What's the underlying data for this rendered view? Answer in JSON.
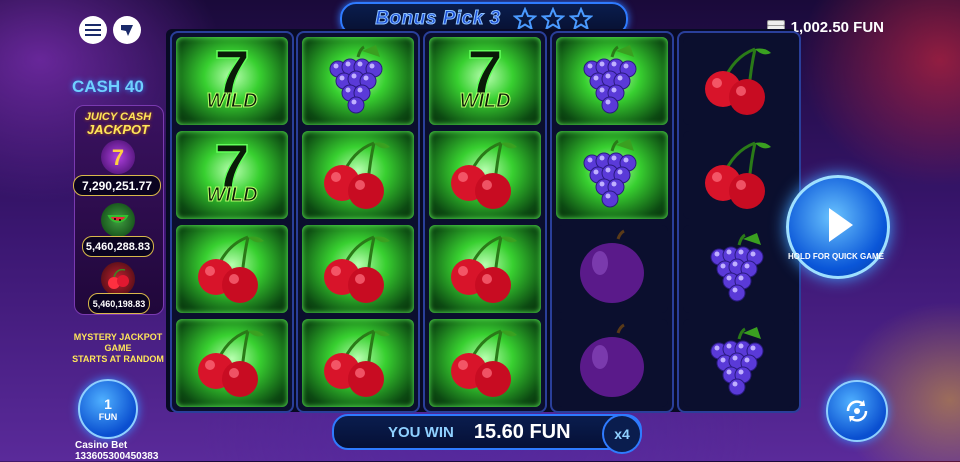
{
  "header": {
    "menu_icon": "hamburger-menu-icon",
    "nav_icon": "arrow-logo-icon",
    "title": "Bonus Pick 3",
    "stars": 3,
    "balance": "1,002.50 FUN",
    "balance_icon": "coin-stack-icon"
  },
  "jackpot": {
    "cash_label": "CASH 40",
    "title_line1": "JUICY CASH",
    "title_line2": "JACKPOT",
    "tiers": [
      {
        "icon": "seven-icon",
        "value": "7,290,251.77"
      },
      {
        "icon": "watermelon-icon",
        "value": "5,460,288.83"
      },
      {
        "icon": "cherry-icon",
        "value": "5,460,198.83"
      }
    ],
    "mystery_line1": "MYSTERY JACKPOT GAME",
    "mystery_line2": "STARTS AT RANDOM"
  },
  "bet": {
    "value": "1",
    "unit": "FUN",
    "label": "Casino Bet",
    "id": "133605300450383"
  },
  "reels": [
    {
      "symbols": [
        "wild",
        "wild",
        "cherry",
        "cherry"
      ],
      "highlight": [
        true,
        true,
        true,
        true
      ]
    },
    {
      "symbols": [
        "grape",
        "cherry",
        "cherry",
        "cherry"
      ],
      "highlight": [
        true,
        true,
        true,
        true
      ]
    },
    {
      "symbols": [
        "wild",
        "cherry",
        "cherry",
        "cherry"
      ],
      "highlight": [
        true,
        true,
        true,
        true
      ]
    },
    {
      "symbols": [
        "grape",
        "grape",
        "plum",
        "plum"
      ],
      "highlight": [
        true,
        true,
        false,
        false
      ]
    },
    {
      "symbols": [
        "cherry",
        "cherry",
        "grape",
        "grape"
      ],
      "highlight": [
        false,
        false,
        false,
        false
      ]
    }
  ],
  "wild_text": "WILD",
  "win": {
    "label": "YOU WIN",
    "amount": "15.60 FUN",
    "multiplier": "x4"
  },
  "controls": {
    "play_label": "HOLD FOR QUICK GAME",
    "play_icon": "play-icon",
    "autoplay_icon": "autoplay-icon"
  },
  "colors": {
    "accent": "#2f7bff",
    "win_glow": "#38d030",
    "jackpot_gold": "#ffe65a"
  }
}
